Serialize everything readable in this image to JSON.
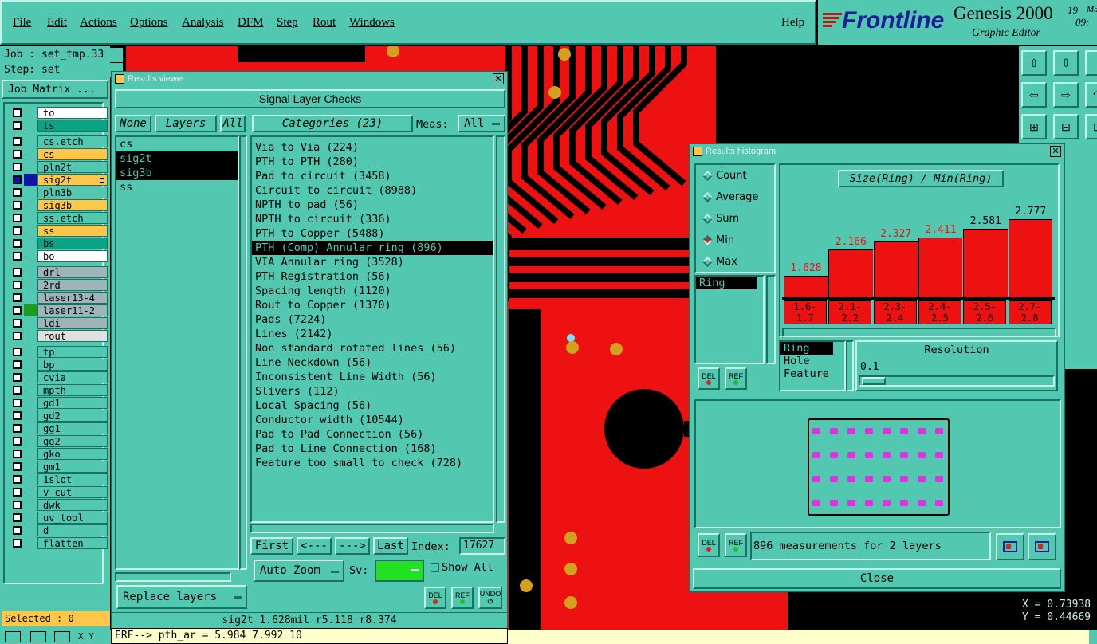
{
  "menu": {
    "items": [
      "File",
      "Edit",
      "Actions",
      "Options",
      "Analysis",
      "DFM",
      "Step",
      "Rout",
      "Windows"
    ],
    "help": "Help"
  },
  "brand": {
    "logo": "Frontline",
    "product": "Genesis 2000",
    "subtitle": "Graphic Editor",
    "date_fragment": "19",
    "date_fragment2": "Ma",
    "time_fragment": "09:"
  },
  "job": {
    "job_label": "Job : set_tmp.33",
    "step_label": "Step: set",
    "matrix_button": "Job Matrix ..."
  },
  "layers": [
    {
      "name": "to",
      "color": "#ffffff",
      "mark": false
    },
    {
      "name": "ts",
      "color": "#0aa383",
      "mark": false
    },
    {
      "name": "cs.etch",
      "color": "#53c8b0",
      "mark": false
    },
    {
      "name": "cs",
      "color": "#ffc74a",
      "mark": false
    },
    {
      "name": "pln2t",
      "color": "#53c8b0",
      "mark": false
    },
    {
      "name": "sig2t",
      "color": "#ffc74a",
      "mark": true
    },
    {
      "name": "pln3b",
      "color": "#53c8b0",
      "mark": false
    },
    {
      "name": "sig3b",
      "color": "#ffc74a",
      "mark": false
    },
    {
      "name": "ss.etch",
      "color": "#53c8b0",
      "mark": false
    },
    {
      "name": "ss",
      "color": "#ffc74a",
      "mark": false
    },
    {
      "name": "bs",
      "color": "#0aa383",
      "mark": false
    },
    {
      "name": "bo",
      "color": "#ffffff",
      "mark": false
    },
    {
      "name": "drl",
      "color": "#9fb4b8",
      "mark": false
    },
    {
      "name": "2rd",
      "color": "#9fb4b8",
      "mark": false
    },
    {
      "name": "laser13-4",
      "color": "#9fb4b8",
      "mark": false
    },
    {
      "name": "laser11-2",
      "color": "#9fb4b8",
      "mark": false,
      "green": true
    },
    {
      "name": "ldi",
      "color": "#9fb4b8",
      "mark": false
    },
    {
      "name": "rout",
      "color": "#e0e0e0",
      "mark": false
    },
    {
      "name": "tp",
      "color": "#53c8b0",
      "mark": false
    },
    {
      "name": "bp",
      "color": "#53c8b0",
      "mark": false
    },
    {
      "name": "cvia",
      "color": "#53c8b0",
      "mark": false
    },
    {
      "name": "mpth",
      "color": "#53c8b0",
      "mark": false
    },
    {
      "name": "gd1",
      "color": "#53c8b0",
      "mark": false
    },
    {
      "name": "gd2",
      "color": "#53c8b0",
      "mark": false
    },
    {
      "name": "gg1",
      "color": "#53c8b0",
      "mark": false
    },
    {
      "name": "gg2",
      "color": "#53c8b0",
      "mark": false
    },
    {
      "name": "gko",
      "color": "#53c8b0",
      "mark": false
    },
    {
      "name": "gm1",
      "color": "#53c8b0",
      "mark": false
    },
    {
      "name": "1slot",
      "color": "#53c8b0",
      "mark": false
    },
    {
      "name": "v-cut",
      "color": "#53c8b0",
      "mark": false
    },
    {
      "name": "dwk",
      "color": "#53c8b0",
      "mark": false
    },
    {
      "name": "uv_tool",
      "color": "#53c8b0",
      "mark": false
    },
    {
      "name": "d",
      "color": "#53c8b0",
      "mark": false
    },
    {
      "name": "flatten",
      "color": "#53c8b0",
      "mark": false
    }
  ],
  "selected_label": "Selected : 0",
  "results_viewer": {
    "title": "Results viewer",
    "header": "Signal Layer Checks",
    "btn_none": "None",
    "btn_layers": "Layers",
    "btn_all": "All",
    "categories_label": "Categories (23)",
    "meas_label": "Meas:",
    "meas_value": "All",
    "layers": [
      "cs",
      "sig2t",
      "sig3b",
      "ss"
    ],
    "selected_layers": [
      "sig2t",
      "sig3b"
    ],
    "categories": [
      "Via to Via (224)",
      "PTH to PTH (280)",
      "Pad to circuit (3458)",
      "Circuit to circuit (8988)",
      "NPTH to pad (56)",
      "NPTH to circuit (336)",
      "PTH to Copper (5488)",
      "PTH (Comp) Annular ring (896)",
      "VIA Annular ring (3528)",
      "PTH Registration (56)",
      "Spacing length (1120)",
      "Rout to Copper (1370)",
      "Pads (7224)",
      "Lines (2142)",
      "Non standard rotated lines (56)",
      "Line Neckdown (56)",
      "Inconsistent Line Width (56)",
      "Slivers (112)",
      "Local Spacing (56)",
      "Conductor width (10544)",
      "Pad to Pad Connection (56)",
      "Pad to Line Connection (168)",
      "Feature too small to check (728)"
    ],
    "selected_category": "PTH (Comp) Annular ring (896)",
    "nav": {
      "first": "First",
      "prev": "<---",
      "next": "--->",
      "last": "Last",
      "index_label": "Index:",
      "index_value": "17627"
    },
    "auto_zoom": "Auto Zoom",
    "sv_label": "Sv:",
    "show_all": "Show All",
    "replace_layers": "Replace layers",
    "del": "DEL",
    "ref": "REF",
    "undo": "UNDO",
    "status": "sig2t 1.628mil  r5.118  r8.374"
  },
  "erf_line": "ERF--> pth_ar = 5.984 7.992 10",
  "histogram": {
    "title": "Results histogram",
    "chart_title": "Size(Ring) / Min(Ring)",
    "modes": [
      "Count",
      "Average",
      "Sum",
      "Min",
      "Max"
    ],
    "selected_mode": "Min",
    "left_list": [
      "Ring"
    ],
    "fields": [
      "Ring",
      "Hole",
      "Feature"
    ],
    "selected_field": "Ring",
    "resolution_label": "Resolution",
    "resolution_value": "0.1",
    "measurements": "896 measurements for 2 layers",
    "close": "Close",
    "del": "DEL",
    "ref": "REF"
  },
  "chart_data": {
    "type": "bar",
    "title": "Size(Ring) / Min(Ring)",
    "categories": [
      "1.6-1.7",
      "2.1-2.2",
      "2.3-2.4",
      "2.4-2.5",
      "2.5-2.6",
      "2.7-2.8"
    ],
    "category_lines": [
      [
        "1.6-",
        "1.7"
      ],
      [
        "2.1-",
        "2.2"
      ],
      [
        "2.3-",
        "2.4"
      ],
      [
        "2.4-",
        "2.5"
      ],
      [
        "2.5-",
        "2.6"
      ],
      [
        "2.7-",
        "2.8"
      ]
    ],
    "values": [
      1.628,
      2.166,
      2.327,
      2.411,
      2.581,
      2.777
    ],
    "value_labels": [
      "1.628",
      "2.166",
      "2.327",
      "2.411",
      "2.581",
      "2.777"
    ],
    "value_label_colors": [
      "#ee1111",
      "#ee1111",
      "#ee1111",
      "#ee1111",
      "#000000",
      "#000000"
    ],
    "bar_color": "#ee1111",
    "ylim": [
      1.2,
      2.9
    ]
  },
  "coords": {
    "x": "X = 0.73938",
    "y": "Y = 0.44669"
  },
  "bottom_xy": "X Y"
}
